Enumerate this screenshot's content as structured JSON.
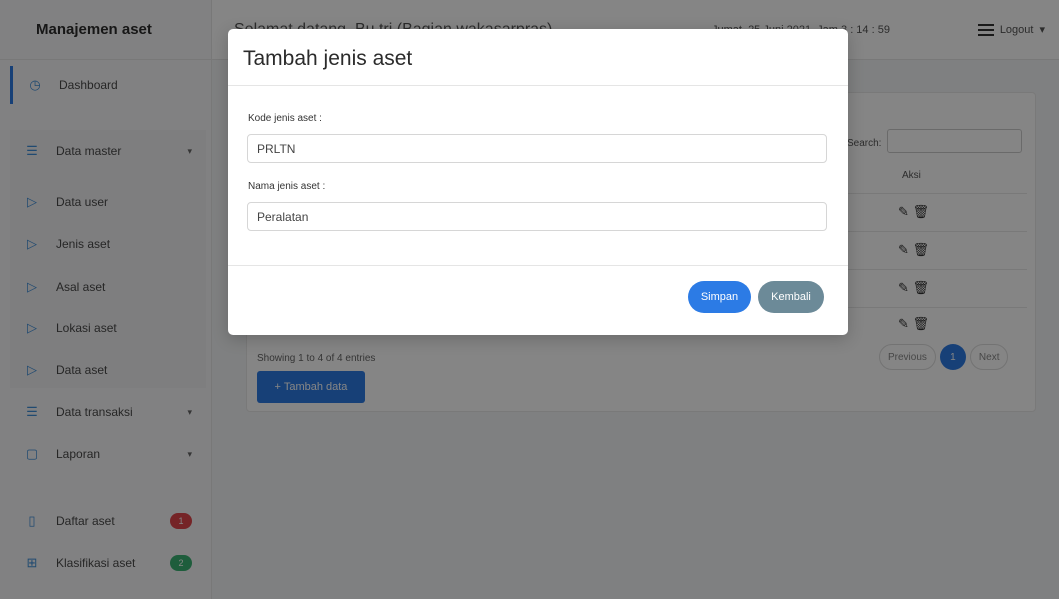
{
  "app": {
    "brand": "Manajemen aset"
  },
  "topbar": {
    "greeting": "Selamat datang, Bu tri (Bagian wakasarpras)",
    "datetime": "Jumat, 25 Juni 2021, Jam 3 : 14 : 59",
    "logout_label": "Logout",
    "menu_icon": "hamburger-icon"
  },
  "sidebar": {
    "items": [
      {
        "label": "Dashboard",
        "icon": "dashboard-icon"
      },
      {
        "label": "Data master",
        "icon": "list-icon",
        "caret": "▾"
      },
      {
        "label": "Data user",
        "icon": "play-icon"
      },
      {
        "label": "Jenis aset",
        "icon": "play-icon"
      },
      {
        "label": "Asal aset",
        "icon": "play-icon"
      },
      {
        "label": "Lokasi aset",
        "icon": "play-icon"
      },
      {
        "label": "Data aset",
        "icon": "play-icon"
      },
      {
        "label": "Data transaksi",
        "icon": "list-icon",
        "caret": "▾"
      },
      {
        "label": "Laporan",
        "icon": "file-icon",
        "caret": "▾"
      },
      {
        "label": "Daftar aset",
        "icon": "clipboard-icon",
        "badge": "1",
        "badge_color": "#e0464c"
      },
      {
        "label": "Klasifikasi aset",
        "icon": "grid-icon",
        "badge": "2",
        "badge_color": "#3bb273"
      }
    ]
  },
  "content": {
    "search_label": "Search:",
    "col_aksi": "Aksi",
    "showing": "Showing 1 to 4 of 4 entries",
    "pager": {
      "prev": "Previous",
      "page": "1",
      "next": "Next"
    },
    "add_button": "+ Tambah data"
  },
  "modal": {
    "title": "Tambah jenis aset",
    "kode_label": "Kode jenis aset :",
    "kode_value": "PRLTN",
    "nama_label": "Nama jenis aset :",
    "nama_value": "Peralatan",
    "simpan": "Simpan",
    "kembali": "Kembali"
  },
  "colors": {
    "accent": "#2c7be5",
    "secondary": "#6c8a98"
  }
}
